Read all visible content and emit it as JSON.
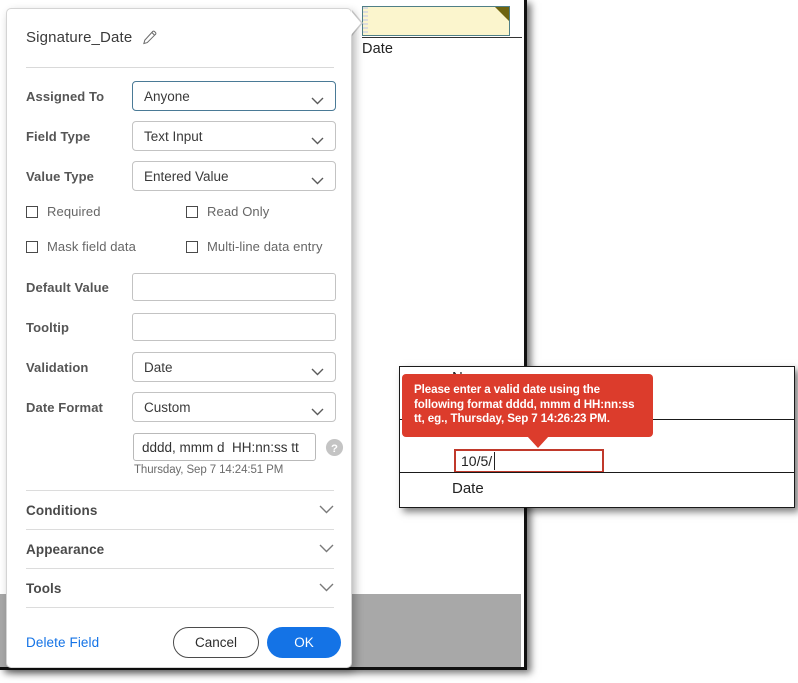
{
  "document_page": {
    "top_field": {
      "name": "highlighted-form-field",
      "label": "Date",
      "fill_color": "#fbf5cd",
      "border_color": "#4f7f86",
      "comment_corner_color": "#6e6410"
    },
    "inner_card": {
      "name_label": "Name",
      "date_label": "Date",
      "date_value": "10/5/",
      "error_border_color": "#c0392b"
    }
  },
  "error_tooltip": {
    "message": "Please enter a valid date using the following format dddd, mmm d HH:nn:ss tt, eg., Thursday, Sep 7 14:26:23 PM.",
    "background_color": "#dc3c2c",
    "text_color": "#ffffff"
  },
  "field_dialog": {
    "title": "Signature_Date",
    "edit_icon": "pencil-icon",
    "rows": {
      "assigned_to": {
        "label": "Assigned To",
        "value": "Anyone",
        "focused": true
      },
      "field_type": {
        "label": "Field Type",
        "value": "Text Input"
      },
      "value_type": {
        "label": "Value Type",
        "value": "Entered Value"
      },
      "default_value": {
        "label": "Default Value",
        "value": "",
        "placeholder": ""
      },
      "tooltip": {
        "label": "Tooltip",
        "value": "",
        "placeholder": ""
      },
      "validation": {
        "label": "Validation",
        "value": "Date"
      },
      "date_format": {
        "label": "Date Format",
        "value": "Custom"
      }
    },
    "checkboxes": [
      {
        "label": "Required",
        "checked": false
      },
      {
        "label": "Read Only",
        "checked": false
      },
      {
        "label": "Mask field data",
        "checked": false
      },
      {
        "label": "Multi-line data entry",
        "checked": false
      }
    ],
    "custom_format": {
      "value": "dddd, mmm d  HH:nn:ss tt",
      "preview": "Thursday, Sep 7 14:24:51 PM",
      "help_icon": "question-mark-icon"
    },
    "accordions": [
      {
        "label": "Conditions",
        "icon": "chevron-down-icon",
        "expanded": false
      },
      {
        "label": "Appearance",
        "icon": "chevron-down-icon",
        "expanded": false
      },
      {
        "label": "Tools",
        "icon": "chevron-down-icon",
        "expanded": false
      }
    ],
    "footer": {
      "delete_label": "Delete Field",
      "cancel_label": "Cancel",
      "ok_label": "OK",
      "link_color": "#1473e6",
      "primary_color": "#1473e6"
    }
  }
}
